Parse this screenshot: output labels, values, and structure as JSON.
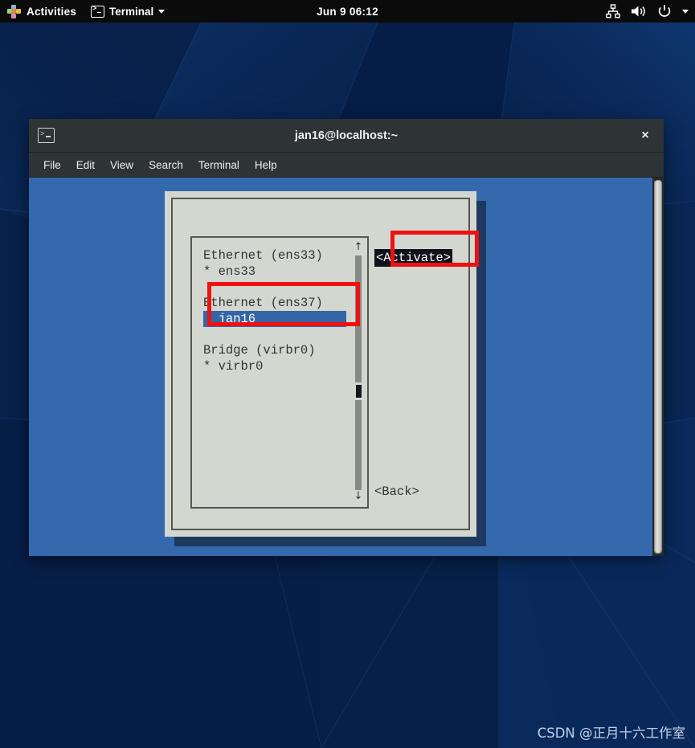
{
  "topbar": {
    "activities_label": "Activities",
    "app_menu_label": "Terminal",
    "clock": "Jun 9  06:12",
    "tray": [
      {
        "name": "network-icon"
      },
      {
        "name": "volume-icon"
      },
      {
        "name": "power-icon"
      },
      {
        "name": "chevron-down-icon"
      }
    ]
  },
  "terminal": {
    "title": "jan16@localhost:~",
    "close_label": "×",
    "menu": [
      "File",
      "Edit",
      "View",
      "Search",
      "Terminal",
      "Help"
    ]
  },
  "nmtui": {
    "connections": [
      {
        "group": "Ethernet (ens33)",
        "name": "* ens33",
        "selected": false
      },
      {
        "group": "Ethernet (ens37)",
        "name": "  jan16",
        "selected": true
      },
      {
        "group": "Bridge (virbr0)",
        "name": "* virbr0",
        "selected": false
      }
    ],
    "scroll": {
      "up_arrow": "↑",
      "down_arrow": "↓"
    },
    "buttons": {
      "activate": "<Activate>",
      "back": "<Back>"
    }
  },
  "annotations": [
    {
      "name": "activate-highlight",
      "color": "#ee1111"
    },
    {
      "name": "ens37-highlight",
      "color": "#ee1111"
    }
  ],
  "watermark": "CSDN @正月十六工作室",
  "colors": {
    "desktop": "#08234f",
    "terminal_bg": "#3569ad",
    "titlebar": "#2e3436",
    "dialog_bg": "#d3d7cf",
    "selection_blue": "#3465a4",
    "annotation_red": "#ee1111"
  }
}
